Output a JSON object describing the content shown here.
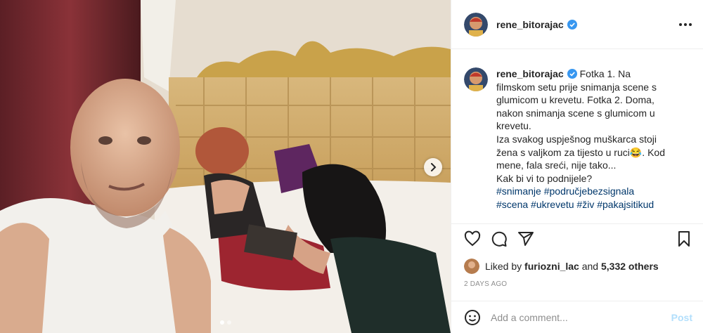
{
  "post": {
    "username": "rene_bitorajac",
    "caption_lines": [
      "Fotka 1. Na",
      "filmskom setu prije snimanja scene s",
      "glumicom u krevetu. Fotka 2. Doma,",
      "nakon snimanja scene s glumicom u",
      "krevetu.",
      "Iza svakog uspješnog muškarca stoji",
      "žena s valjkom za tijesto u ruci😂. Kod",
      "mene, fala sreći, nije tako...",
      "Kak bi vi to podnijele?"
    ],
    "hashtag_lines": [
      [
        "#snimanje",
        "#područjebezsignala"
      ],
      [
        "#scena",
        "#ukrevetu",
        "#živ",
        "#pakajsitikud"
      ]
    ],
    "liked_by_prefix": "Liked by",
    "liked_by_user": "furiozni_lac",
    "liked_and": "and",
    "liked_others": "5,332 others",
    "time": "2 DAYS AGO",
    "comment_placeholder": "Add a comment...",
    "post_button": "Post"
  },
  "carousel": {
    "count": 2,
    "active": 0
  },
  "colors": {
    "link": "#00376b",
    "verified": "#3897f0",
    "post_disabled": "#b2dffc"
  },
  "icons": [
    "heart-icon",
    "comment-icon",
    "share-icon",
    "bookmark-icon",
    "emoji-icon",
    "more-icon",
    "chevron-right-icon",
    "verified-icon"
  ]
}
